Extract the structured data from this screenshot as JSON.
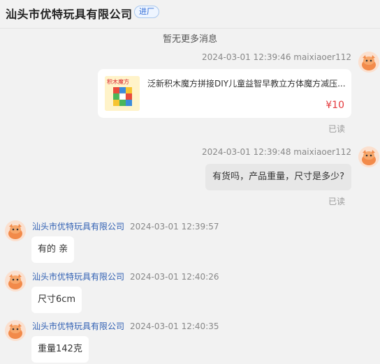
{
  "header": {
    "shop_name": "汕头市优特玩具有限公司",
    "tag": "进厂"
  },
  "notice": "暂无更多消息",
  "messages": [
    {
      "side": "right",
      "meta": "2024-03-01 12:39:46  maixiaoer112",
      "type": "product",
      "product_title": "泛新积木魔方拼接DIY儿童益智早教立方体魔方减压...",
      "product_price": "¥10",
      "product_image_caption": "积木魔方",
      "status": "已读"
    },
    {
      "side": "right",
      "meta": "2024-03-01 12:39:48  maixiaoer112",
      "type": "text",
      "text": "有货吗，产品重量，尺寸是多少?",
      "status": "已读"
    },
    {
      "side": "left",
      "sender": "汕头市优特玩具有限公司",
      "time": "2024-03-01 12:39:57",
      "text": "有的 亲"
    },
    {
      "side": "left",
      "sender": "汕头市优特玩具有限公司",
      "time": "2024-03-01 12:40:26",
      "text": "尺寸6cm"
    },
    {
      "side": "left",
      "sender": "汕头市优特玩具有限公司",
      "time": "2024-03-01 12:40:35",
      "text": "重量142克"
    }
  ],
  "icons": {
    "avatar": "cartoon-avatar-icon"
  },
  "colors": {
    "price": "#e4393c",
    "sender_name": "#2f5fb3",
    "tag_text": "#2f6bd6"
  }
}
